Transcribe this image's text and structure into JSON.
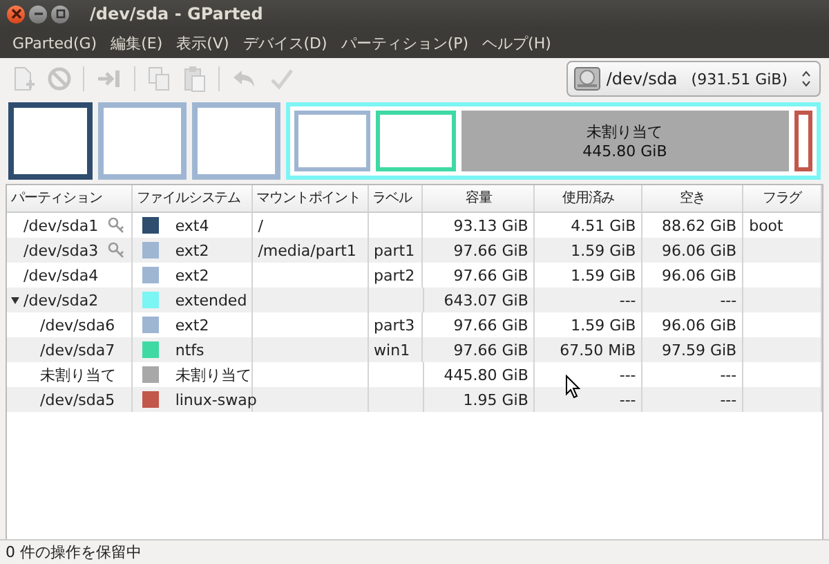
{
  "window": {
    "title": "/dev/sda - GParted"
  },
  "menu": [
    "GParted(G)",
    "編集(E)",
    "表示(V)",
    "デバイス(D)",
    "パーティション(P)",
    "ヘルプ(H)"
  ],
  "device_selector": {
    "value": "/dev/sda",
    "size": "(931.51 GiB)"
  },
  "graph": [
    {
      "kind": "partition",
      "color": "#2e4d6f"
    },
    {
      "kind": "partition",
      "color": "#9fb6d3"
    },
    {
      "kind": "partition",
      "color": "#9fb6d3"
    },
    {
      "kind": "extended",
      "color": "#7cf5f5",
      "children": [
        {
          "kind": "partition",
          "color": "#9fb6d3"
        },
        {
          "kind": "partition",
          "color": "#3fd9a4"
        },
        {
          "kind": "unallocated",
          "color": "#a8a8a8",
          "label": "未割り当て",
          "size": "445.80 GiB"
        },
        {
          "kind": "partition",
          "color": "#c2574b"
        }
      ]
    }
  ],
  "table": {
    "columns": [
      "パーティション",
      "ファイルシステム",
      "マウントポイント",
      "ラベル",
      "容量",
      "使用済み",
      "空き",
      "フラグ"
    ],
    "rows": [
      {
        "partition": "/dev/sda1",
        "mounted": true,
        "color": "#2e4d6f",
        "filesystem": "ext4",
        "mount_point": "/",
        "size": "93.13 GiB",
        "used": "4.51 GiB",
        "free": "88.62 GiB",
        "flags": "boot"
      },
      {
        "partition": "/dev/sda3",
        "mounted": true,
        "color": "#9fb6d3",
        "filesystem": "ext2",
        "mount_point": "/media/part1",
        "label": "part1",
        "size": "97.66 GiB",
        "used": "1.59 GiB",
        "free": "96.06 GiB"
      },
      {
        "partition": "/dev/sda4",
        "mounted": false,
        "color": "#9fb6d3",
        "filesystem": "ext2",
        "label": "part2",
        "size": "97.66 GiB",
        "used": "1.59 GiB",
        "free": "96.06 GiB"
      },
      {
        "partition": "/dev/sda2",
        "mounted": false,
        "color": "#7cf5f5",
        "filesystem": "extended",
        "size": "643.07 GiB",
        "used": "---",
        "free": "---",
        "expanded": true,
        "children": [
          {
            "partition": "/dev/sda6",
            "mounted": false,
            "color": "#9fb6d3",
            "filesystem": "ext2",
            "label": "part3",
            "size": "97.66 GiB",
            "used": "1.59 GiB",
            "free": "96.06 GiB"
          },
          {
            "partition": "/dev/sda7",
            "mounted": false,
            "color": "#3fd9a4",
            "filesystem": "ntfs",
            "label": "win1",
            "size": "97.66 GiB",
            "used": "67.50 MiB",
            "free": "97.59 GiB"
          },
          {
            "partition": "未割り当て",
            "mounted": false,
            "color": "#a8a8a8",
            "filesystem": "未割り当て",
            "size": "445.80 GiB",
            "used": "---",
            "free": "---"
          },
          {
            "partition": "/dev/sda5",
            "mounted": false,
            "color": "#c2574b",
            "filesystem": "linux-swap",
            "size": "1.95 GiB",
            "used": "---",
            "free": "---"
          }
        ]
      }
    ]
  },
  "status_bar": "0 件の操作を保留中"
}
